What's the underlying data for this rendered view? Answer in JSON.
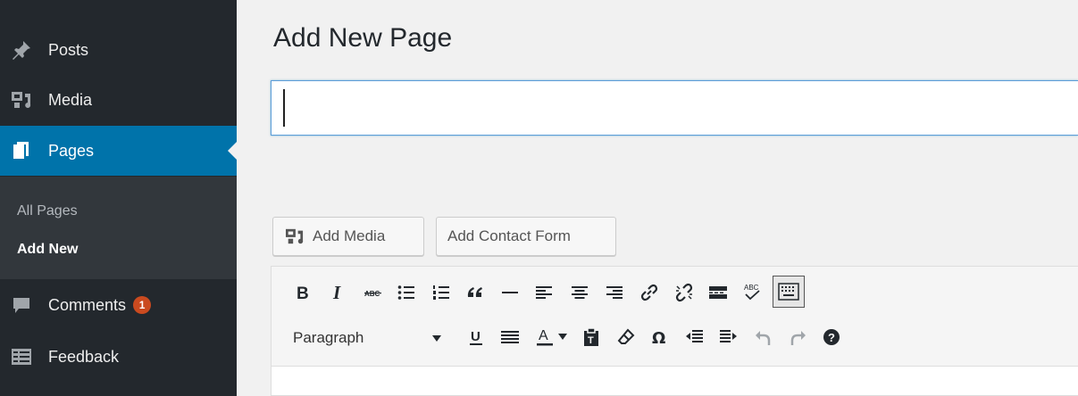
{
  "sidebar": {
    "items": [
      {
        "label": "Posts",
        "icon": "pin-icon"
      },
      {
        "label": "Media",
        "icon": "media-icon"
      },
      {
        "label": "Pages",
        "icon": "pages-icon",
        "active": true
      },
      {
        "label": "Comments",
        "icon": "comment-icon",
        "badge": "1"
      },
      {
        "label": "Feedback",
        "icon": "feedback-icon"
      }
    ],
    "submenu": [
      {
        "label": "All Pages"
      },
      {
        "label": "Add New",
        "current": true
      }
    ]
  },
  "main": {
    "page_title": "Add New Page",
    "title_input": {
      "value": "",
      "placeholder": ""
    },
    "buttons": {
      "add_media": "Add Media",
      "add_contact_form": "Add Contact Form"
    },
    "editor": {
      "format_select": "Paragraph",
      "row1": [
        "bold",
        "italic",
        "strikethrough",
        "bulleted-list",
        "numbered-list",
        "blockquote",
        "horizontal-line",
        "align-left",
        "align-center",
        "align-right",
        "insert-link",
        "remove-link",
        "read-more",
        "spellcheck",
        "toolbar-toggle"
      ],
      "row2": [
        "underline",
        "justify",
        "text-color",
        "paste-as-text",
        "clear-formatting",
        "special-character",
        "outdent",
        "indent",
        "undo",
        "redo",
        "help"
      ]
    }
  },
  "colors": {
    "sidebar_bg": "#23282d",
    "submenu_bg": "#32373c",
    "active_bg": "#0073aa",
    "badge_bg": "#ca4a1f",
    "page_bg": "#f1f1f1"
  }
}
